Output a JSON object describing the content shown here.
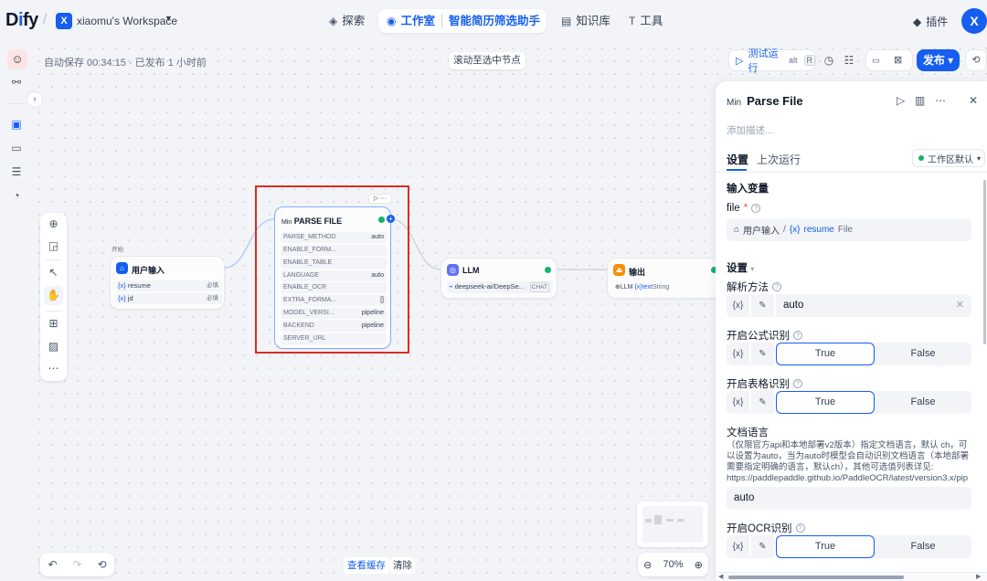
{
  "header": {
    "logo_prefix": "D",
    "logo_i": "i",
    "logo_suffix": "fy",
    "workspace_badge": "X",
    "workspace_name": "xiaomu's Workspace",
    "nav": {
      "explore": "探索",
      "studio": "工作室",
      "app_name": "智能简历筛选助手",
      "knowledge": "知识库",
      "tools": "工具"
    },
    "plugins": "插件",
    "avatar": "X"
  },
  "canvas": {
    "autosave": "自动保存 00:34:15 · 已发布 1 小时前",
    "scroll_to_node": "滚动至选中节点",
    "view_cache": "查看缓存",
    "clear": "清除",
    "zoom": "70%"
  },
  "actions": {
    "test_run": "测试运行",
    "shortcut_alt": "alt",
    "shortcut_r": "R",
    "publish": "发布"
  },
  "nodes": {
    "start": {
      "tag": "开始",
      "title": "用户输入",
      "vars": [
        {
          "name": "resume",
          "req": "必填"
        },
        {
          "name": "jd",
          "req": "必填"
        }
      ]
    },
    "parse": {
      "prefix": "Min",
      "title": "PARSE FILE",
      "params": [
        {
          "name": "PARSE_METHOD",
          "value": "auto"
        },
        {
          "name": "ENABLE_FORM...",
          "value": ""
        },
        {
          "name": "ENABLE_TABLE",
          "value": ""
        },
        {
          "name": "LANGUAGE",
          "value": "auto"
        },
        {
          "name": "ENABLE_OCR",
          "value": ""
        },
        {
          "name": "EXTRA_FORMA...",
          "value": "[]"
        },
        {
          "name": "MODEL_VERSI...",
          "value": "pipeline"
        },
        {
          "name": "BACKEND",
          "value": "pipeline"
        },
        {
          "name": "SERVER_URL",
          "value": ""
        }
      ]
    },
    "llm": {
      "title": "LLM",
      "model": "deepseek-ai/DeepSe...",
      "mode": "CHAT"
    },
    "output": {
      "title": "输出",
      "src": "LLM",
      "var": "text",
      "type": "String"
    }
  },
  "panel": {
    "prefix": "Min",
    "title": "Parse File",
    "desc_placeholder": "添加描述...",
    "tabs": [
      "设置",
      "上次运行"
    ],
    "env": "工作区默认",
    "input_vars": "输入变量",
    "file_label": "file",
    "file_src": "用户输入",
    "file_var": "resume",
    "file_type": "File",
    "settings": "设置",
    "parse_method": "解析方法",
    "parse_method_value": "auto",
    "formula": "开启公式识别",
    "table": "开启表格识别",
    "true_label": "True",
    "false_label": "False",
    "doc_lang": "文档语言",
    "doc_lang_desc": "（仅限官方api和本地部署v2版本）指定文档语言，默认 ch，可以设置为auto，当为auto时模型会自动识别文档语言（本地部署需要指定明确的语言，默认ch），其他可选值列表详见:\nhttps://paddlepaddle.github.io/PaddleOCR/latest/version3.x/pip",
    "doc_lang_value": "auto",
    "ocr": "开启OCR识别"
  }
}
